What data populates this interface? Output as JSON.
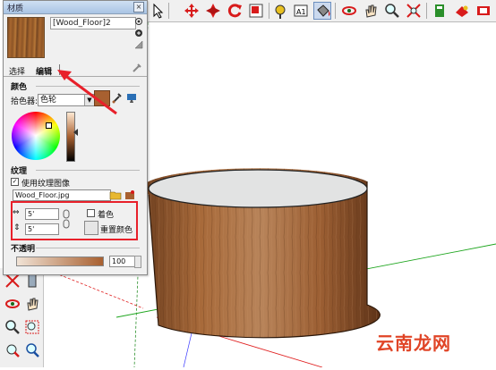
{
  "panel": {
    "title": "材质",
    "close": "×",
    "material_name": "[Wood_Floor]2",
    "tabs": [
      "选择",
      "编辑"
    ],
    "color_section": "颜色",
    "picker_label": "拾色器:",
    "picker_value": "色轮",
    "texture_section": "纹理",
    "use_texture_label": "使用纹理图像",
    "texture_file": "Wood_Floor.jpg",
    "width_value": "5'",
    "height_value": "5'",
    "colorize_label": "着色",
    "reset_color_label": "重置颜色",
    "opacity_section": "不透明",
    "opacity_value": "100",
    "checked_mark": "✓"
  },
  "watermark": "云南龙网",
  "colors": {
    "highlight": "#e8202a",
    "wood": "#a86030"
  },
  "icons": [
    "eye-icon",
    "add-material-icon",
    "hand-icon",
    "zoom-icon",
    "eyedropper-icon",
    "paint-bucket-icon",
    "chain-link-icon"
  ]
}
